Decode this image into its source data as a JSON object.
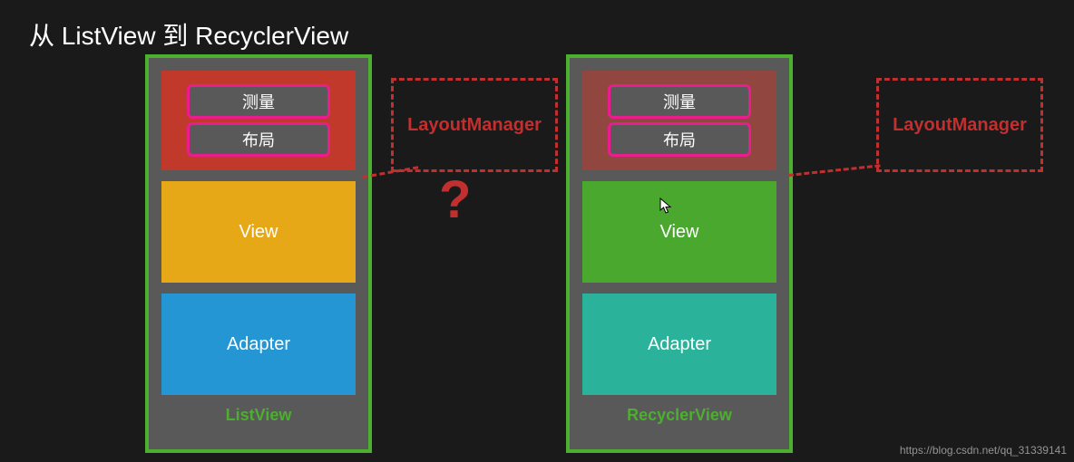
{
  "title": "从 ListView 到 RecyclerView",
  "left": {
    "measure": "测量",
    "layout": "布局",
    "view": "View",
    "adapter": "Adapter",
    "caption": "ListView",
    "callout": "LayoutManager",
    "question": "?"
  },
  "right": {
    "measure": "测量",
    "layout": "布局",
    "view": "View",
    "adapter": "Adapter",
    "caption": "RecyclerView",
    "callout": "LayoutManager"
  },
  "credit": "https://blog.csdn.net/qq_31339141"
}
